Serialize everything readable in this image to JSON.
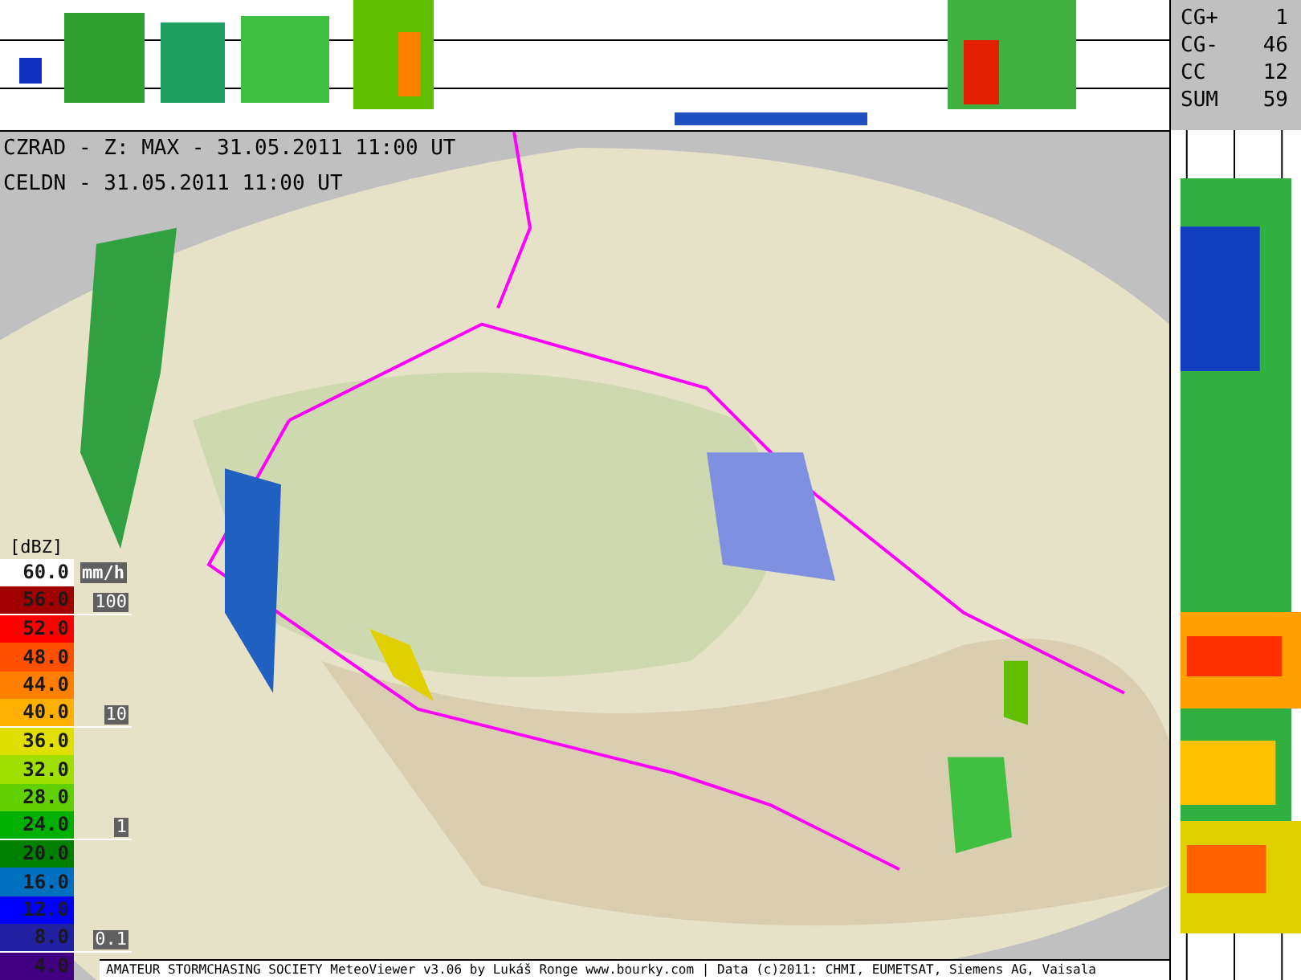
{
  "header": {
    "lines": [
      "CZRAD - Z: MAX - 31.05.2011 11:00 UT",
      "CELDN - 31.05.2011 11:00 UT"
    ]
  },
  "lightning_stats": [
    {
      "label": "CG+",
      "value": "1"
    },
    {
      "label": "CG-",
      "value": "46"
    },
    {
      "label": "CC",
      "value": "12"
    },
    {
      "label": "SUM",
      "value": "59"
    }
  ],
  "legend": {
    "unit": "[dBZ]",
    "rain_unit": "mm/h",
    "items": [
      {
        "label": "60.0",
        "color": "#ffffff"
      },
      {
        "label": "56.0",
        "color": "#a00000",
        "rain_mark": "100"
      },
      {
        "label": "52.0",
        "color": "#ff0000"
      },
      {
        "label": "48.0",
        "color": "#ff5000"
      },
      {
        "label": "44.0",
        "color": "#ff8000"
      },
      {
        "label": "40.0",
        "color": "#ffb000",
        "rain_mark": "10"
      },
      {
        "label": "36.0",
        "color": "#e0e000"
      },
      {
        "label": "32.0",
        "color": "#a0e000"
      },
      {
        "label": "28.0",
        "color": "#60d000"
      },
      {
        "label": "24.0",
        "color": "#00b000",
        "rain_mark": "1"
      },
      {
        "label": "20.0",
        "color": "#008000"
      },
      {
        "label": "16.0",
        "color": "#0070c0"
      },
      {
        "label": "12.0",
        "color": "#0000ff"
      },
      {
        "label": "8.0",
        "color": "#2020a0",
        "rain_mark": "0.1"
      },
      {
        "label": "4.0",
        "color": "#400080"
      }
    ]
  },
  "footer": "AMATEUR STORMCHASING SOCIETY MeteoViewer v3.06 by Lukáš Ronge www.bourky.com | Data (c)2011: CHMI, EUMETSAT, Siemens AG, Vaisala"
}
